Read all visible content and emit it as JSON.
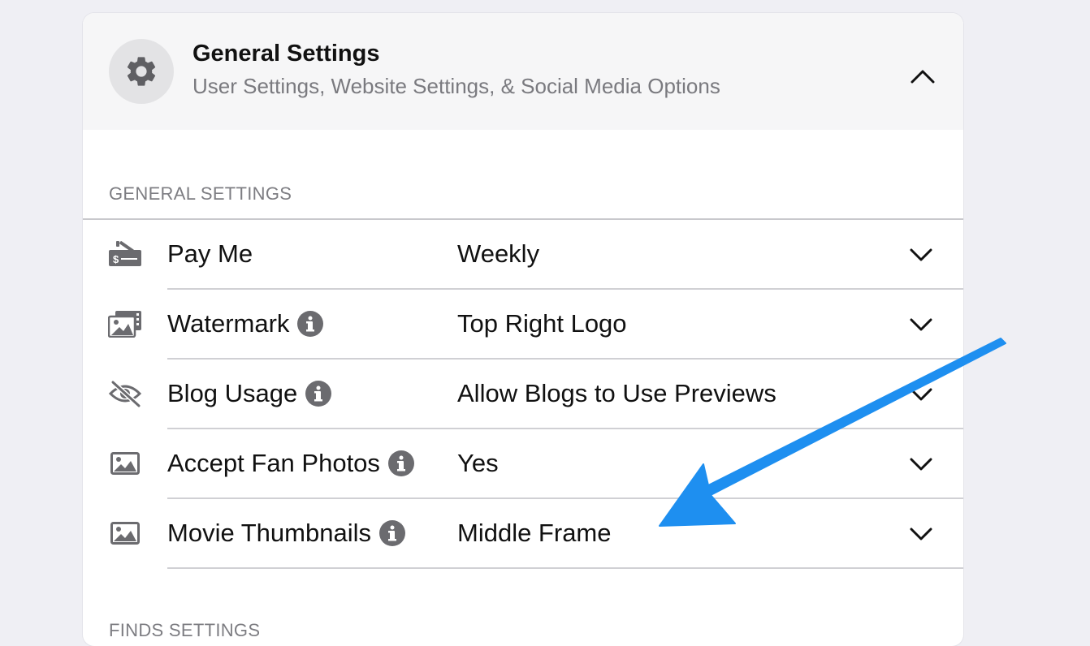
{
  "header": {
    "title": "General Settings",
    "subtitle": "User Settings, Website Settings, & Social Media Options",
    "icon": "gear-icon",
    "toggle_icon": "chevron-up-icon"
  },
  "section": {
    "label": "GENERAL SETTINGS",
    "next_label": "FINDS SETTINGS"
  },
  "rows": [
    {
      "label": "Pay Me",
      "value": "Weekly",
      "icon": "payment-check-icon",
      "info": false
    },
    {
      "label": "Watermark",
      "value": "Top Right Logo",
      "icon": "photos-icon",
      "info": true
    },
    {
      "label": "Blog Usage",
      "value": "Allow Blogs to Use Previews",
      "icon": "eye-slash-icon",
      "info": true
    },
    {
      "label": "Accept Fan Photos",
      "value": "Yes",
      "icon": "image-icon",
      "info": true
    },
    {
      "label": "Movie Thumbnails",
      "value": "Middle Frame",
      "icon": "image-icon",
      "info": true
    }
  ],
  "colors": {
    "background": "#efeff4",
    "card": "#ffffff",
    "header": "#f6f6f7",
    "icon_gray": "#6b6b6f",
    "annotation_arrow": "#1e8ff0"
  }
}
